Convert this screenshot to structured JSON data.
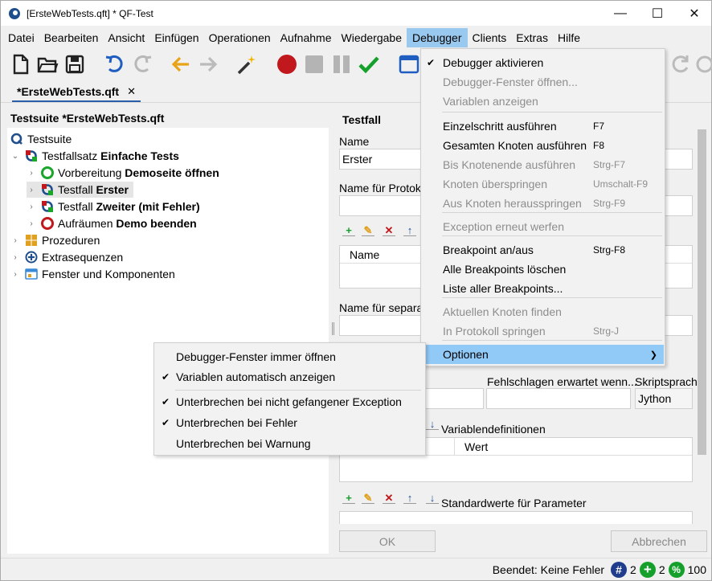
{
  "window": {
    "title": "[ErsteWebTests.qft] * QF-Test"
  },
  "menubar": [
    "Datei",
    "Bearbeiten",
    "Ansicht",
    "Einfügen",
    "Operationen",
    "Aufnahme",
    "Wiedergabe",
    "Debugger",
    "Clients",
    "Extras",
    "Hilfe"
  ],
  "tab": {
    "label": "*ErsteWebTests.qft",
    "close": "✕"
  },
  "tree": {
    "title": "Testsuite *ErsteWebTests.qft",
    "nodes": [
      {
        "prefix": "Testsuite",
        "bold": ""
      },
      {
        "prefix": "Testfallsatz ",
        "bold": "Einfache Tests"
      },
      {
        "prefix": "Vorbereitung ",
        "bold": "Demoseite öffnen"
      },
      {
        "prefix": "Testfall ",
        "bold": "Erster"
      },
      {
        "prefix": "Testfall ",
        "bold": "Zweiter (mit Fehler)"
      },
      {
        "prefix": "Aufräumen ",
        "bold": "Demo beenden"
      },
      {
        "prefix": "Prozeduren",
        "bold": ""
      },
      {
        "prefix": "Extrasequenzen",
        "bold": ""
      },
      {
        "prefix": "Fenster und Komponenten",
        "bold": ""
      }
    ]
  },
  "detail": {
    "title": "Testfall",
    "name_label": "Name",
    "name_value": "Erster",
    "protocol_label": "Name für Protok",
    "table_col": "Name",
    "separate_label": "Name für separa",
    "fail_label": "Fehlschlagen erwartet wenn...",
    "script_label": "Skriptsprach",
    "script_value": "Jython",
    "vardef_label": "Variablendefinitionen",
    "vardef_col": "Wert",
    "defaults_label": "Standardwerte für Parameter",
    "ok": "OK",
    "cancel": "Abbrechen"
  },
  "debugger_menu": [
    {
      "label": "Debugger aktivieren",
      "check": "✔",
      "shortcut": "",
      "disabled": false
    },
    {
      "label": "Debugger-Fenster öffnen...",
      "check": "",
      "shortcut": "",
      "disabled": true
    },
    {
      "label": "Variablen anzeigen",
      "check": "",
      "shortcut": "",
      "disabled": true
    },
    {
      "label": "Einzelschritt ausführen",
      "check": "",
      "shortcut": "F7",
      "disabled": false
    },
    {
      "label": "Gesamten Knoten ausführen",
      "check": "",
      "shortcut": "F8",
      "disabled": false
    },
    {
      "label": "Bis Knotenende ausführen",
      "check": "",
      "shortcut": "Strg-F7",
      "disabled": true
    },
    {
      "label": "Knoten überspringen",
      "check": "",
      "shortcut": "Umschalt-F9",
      "disabled": true
    },
    {
      "label": "Aus Knoten herausspringen",
      "check": "",
      "shortcut": "Strg-F9",
      "disabled": true
    },
    {
      "label": "Exception erneut werfen",
      "check": "",
      "shortcut": "",
      "disabled": true
    },
    {
      "label": "Breakpoint an/aus",
      "check": "",
      "shortcut": "Strg-F8",
      "disabled": false
    },
    {
      "label": "Alle Breakpoints löschen",
      "check": "",
      "shortcut": "",
      "disabled": false
    },
    {
      "label": "Liste aller Breakpoints...",
      "check": "",
      "shortcut": "",
      "disabled": false
    },
    {
      "label": "Aktuellen Knoten finden",
      "check": "",
      "shortcut": "",
      "disabled": true
    },
    {
      "label": "In Protokoll springen",
      "check": "",
      "shortcut": "Strg-J",
      "disabled": true
    },
    {
      "label": "Optionen",
      "check": "",
      "shortcut": "",
      "disabled": false
    }
  ],
  "options_menu": [
    {
      "label": "Debugger-Fenster immer öffnen",
      "check": ""
    },
    {
      "label": "Variablen automatisch anzeigen",
      "check": "✔"
    },
    {
      "label": "Unterbrechen bei nicht gefangener Exception",
      "check": "✔"
    },
    {
      "label": "Unterbrechen bei Fehler",
      "check": "✔"
    },
    {
      "label": "Unterbrechen bei Warnung",
      "check": ""
    }
  ],
  "status": {
    "text": "Beendet: Keine Fehler",
    "count1": "2",
    "count2": "2",
    "percent": "100"
  },
  "colors": {
    "menu_highlight": "#91c9f7",
    "menubar_active": "#99c9ef",
    "tab_underline": "#2a5ea8"
  },
  "icons": {
    "new": "new-file-icon",
    "open": "open-folder-icon",
    "save": "save-icon",
    "undo": "undo-icon",
    "redo": "redo-icon",
    "back": "back-arrow-icon",
    "forward": "forward-arrow-icon",
    "wand": "magic-wand-icon",
    "record": "record-icon",
    "stop": "stop-icon",
    "pause": "pause-icon",
    "check": "check-icon",
    "window": "window-icon"
  }
}
